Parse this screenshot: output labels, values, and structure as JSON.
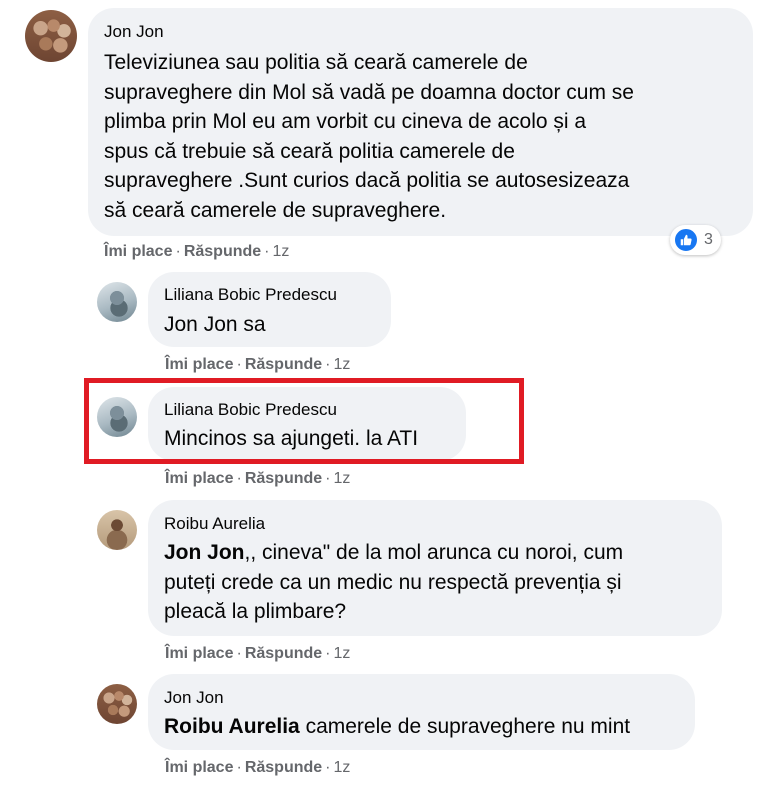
{
  "actions": {
    "like_label": "Îmi place",
    "reply_label": "Răspunde",
    "separator": "·"
  },
  "comments": [
    {
      "author": "Jon Jon",
      "text_lines": [
        "Televiziunea sau politia să ceară camerele de",
        "supraveghere din Mol să vadă pe doamna doctor cum se",
        "plimba prin Mol eu am vorbit cu cineva de acolo și a",
        "spus că trebuie să ceară politia camerele de",
        "supraveghere .Sunt curios dacă politia se autosesizeaza",
        "să ceară camerele de supraveghere."
      ],
      "time": "1z",
      "reaction_count": "3",
      "reaction_icon": "like-icon"
    },
    {
      "author": "Liliana Bobic Predescu",
      "text": "Jon Jon sa",
      "time": "1z"
    },
    {
      "author": "Liliana Bobic Predescu",
      "text": "Mincinos sa ajungeti. la ATI",
      "time": "1z",
      "highlighted": true,
      "highlight_color": "#e01b24"
    },
    {
      "author": "Roibu Aurelia",
      "mention": "Jon Jon",
      "text_lines": [
        ",, cineva\" de la mol arunca cu noroi, cum",
        "puteți crede ca un medic nu respectă prevenția și",
        "pleacă la plimbare?"
      ],
      "time": "1z"
    },
    {
      "author": "Jon Jon",
      "mention": "Roibu Aurelia",
      "text": " camerele de supraveghere nu mint",
      "time": "1z"
    }
  ],
  "colors": {
    "bubble": "#f0f2f5",
    "meta_text": "#65676b",
    "like_blue": "#1877f2"
  }
}
